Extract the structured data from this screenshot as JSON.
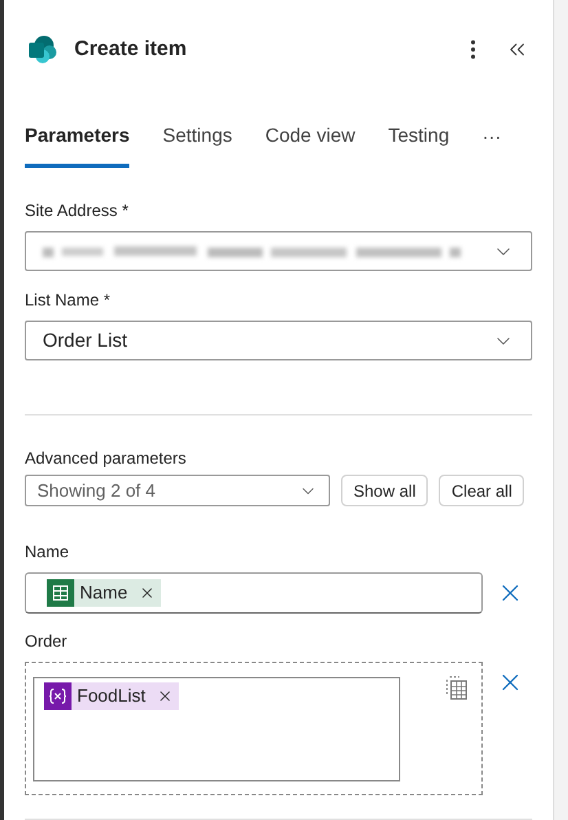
{
  "header": {
    "title": "Create item"
  },
  "tabs": [
    {
      "label": "Parameters",
      "selected": true
    },
    {
      "label": "Settings",
      "selected": false
    },
    {
      "label": "Code view",
      "selected": false
    },
    {
      "label": "Testing",
      "selected": false
    }
  ],
  "tabs_overflow": "···",
  "fields": [
    {
      "label": "Site Address *",
      "kind": "redacted"
    },
    {
      "label": "List Name *",
      "kind": "dropdown",
      "value": "Order List"
    }
  ],
  "advanced": {
    "label": "Advanced parameters",
    "value": "Showing 2 of 4",
    "buttons": [
      "Show all",
      "Clear all"
    ]
  },
  "params": [
    {
      "label": "Name",
      "kind": "text",
      "tokens": [
        {
          "kind": "excel",
          "text": "Name"
        }
      ]
    },
    {
      "label": "Order",
      "kind": "dropzone",
      "tokens": [
        {
          "kind": "variable",
          "text": "FoodList"
        }
      ]
    }
  ]
}
